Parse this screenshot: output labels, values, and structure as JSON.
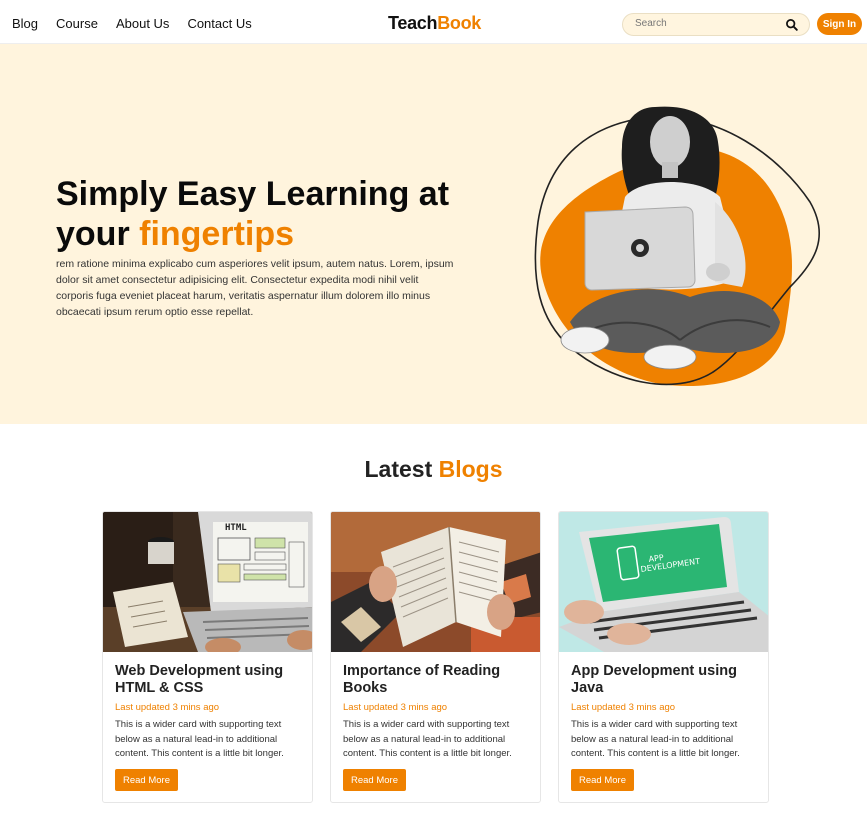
{
  "nav": {
    "links": [
      "Blog",
      "Course",
      "About Us",
      "Contact Us"
    ],
    "brand_part1": "Teach",
    "brand_part2": "Book",
    "search_placeholder": "Search",
    "search_icon": "search-icon",
    "signin_label": "Sign In"
  },
  "hero": {
    "title_line1": "Simply Easy Learning at",
    "title_line2_prefix": "your ",
    "title_accent": "fingertips",
    "text": "rem ratione minima explicabo cum asperiores velit ipsum, autem natus. Lorem, ipsum dolor sit amet consectetur adipisicing elit. Consectetur expedita modi nihil velit corporis fuga eveniet placeat harum, veritatis aspernatur illum dolorem illo minus obcaecati ipsum rerum optio esse repellat."
  },
  "blogs": {
    "title_prefix": "Latest ",
    "title_accent": "Blogs",
    "cards": [
      {
        "title": "Web Development using HTML & CSS",
        "updated": "Last updated 3 mins ago",
        "desc": "This is a wider card with supporting text below as a natural lead-in to additional content. This content is a little bit longer.",
        "button": "Read More"
      },
      {
        "title": "Importance of Reading Books",
        "updated": "Last updated 3 mins ago",
        "desc": "This is a wider card with supporting text below as a natural lead-in to additional content. This content is a little bit longer.",
        "button": "Read More"
      },
      {
        "title": "App Development using Java",
        "updated": "Last updated 3 mins ago",
        "desc": "This is a wider card with supporting text below as a natural lead-in to additional content. This content is a little bit longer.",
        "button": "Read More"
      }
    ]
  },
  "images": {
    "card1_screen_text": "HTML",
    "card3_screen_text_1": "APP",
    "card3_screen_text_2": "DEVELOPMENT"
  },
  "colors": {
    "accent": "#ef8100",
    "hero_bg": "#fff4dd",
    "app_screen_green": "#2bb673"
  }
}
